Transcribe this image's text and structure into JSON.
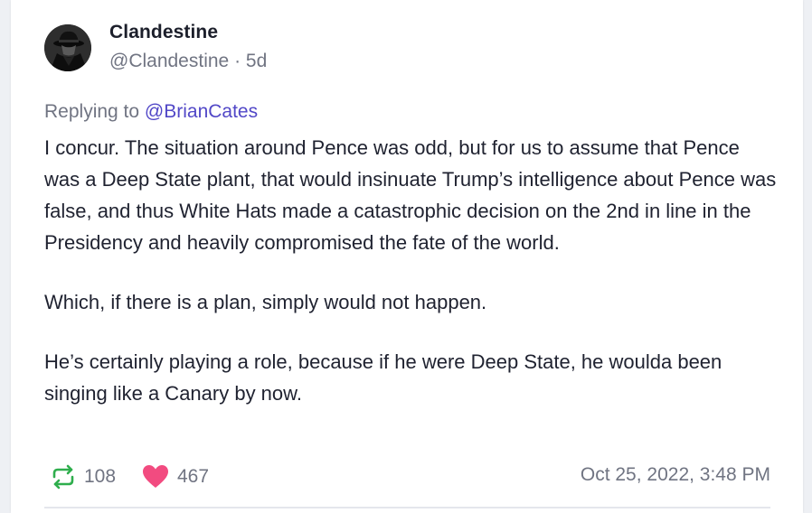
{
  "post": {
    "author": {
      "display_name": "Clandestine",
      "handle": "@Clandestine",
      "separator": "·",
      "age": "5d"
    },
    "reply": {
      "prefix": "Replying to",
      "mention": "@BrianCates"
    },
    "paragraphs": [
      "I concur. The situation around Pence was odd, but for us to assume that Pence was a Deep State plant, that would insinuate Trump’s intelligence about Pence was false, and thus White Hats made a catastrophic decision on the 2nd in line in the Presidency and heavily compromised the fate of the world.",
      "Which, if there is a plan, simply would not happen.",
      "He’s certainly playing a role, because if he were Deep State, he woulda been singing like a Canary by now."
    ],
    "stats": {
      "retweets": "108",
      "likes": "467"
    },
    "timestamp": "Oct 25, 2022, 3:48 PM"
  },
  "icons": {
    "retweet": "retweet-icon",
    "like": "heart-icon",
    "avatar": "spy-avatar"
  },
  "colors": {
    "mention": "#5147c7",
    "retweet": "#2fae4d",
    "heart": "#f24b80",
    "muted": "#707482"
  }
}
